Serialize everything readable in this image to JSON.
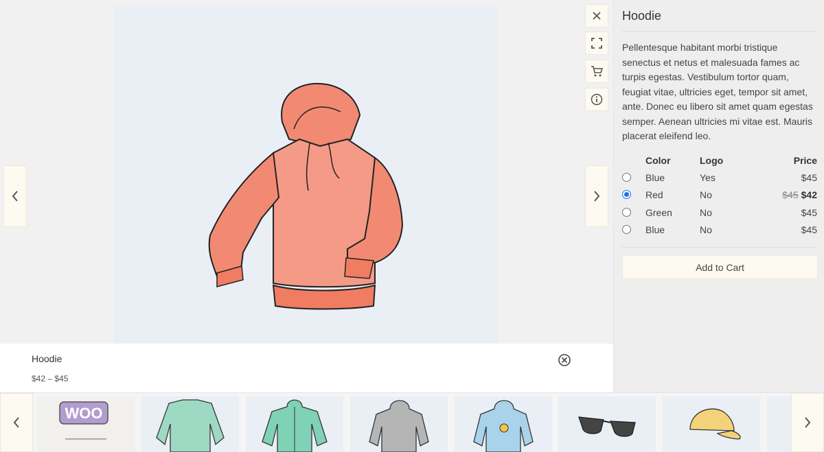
{
  "product": {
    "title": "Hoodie",
    "price_range": "$42 – $45",
    "description": "Pellentesque habitant morbi tristique senectus et netus et malesuada fames ac turpis egestas. Vestibulum tortor quam, feugiat vitae, ultricies eget, tempor sit amet, ante. Donec eu libero sit amet quam egestas semper. Aenean ultricies mi vitae est. Mauris placerat eleifend leo."
  },
  "toolbar": {
    "close_icon": "close-icon",
    "fullscreen_icon": "fullscreen-icon",
    "cart_icon": "cart-icon",
    "info_icon": "info-icon"
  },
  "variations": {
    "headers": {
      "color": "Color",
      "logo": "Logo",
      "price": "Price"
    },
    "rows": [
      {
        "color": "Blue",
        "logo": "Yes",
        "price": "$45",
        "old_price": "",
        "selected": false
      },
      {
        "color": "Red",
        "logo": "No",
        "price": "$42",
        "old_price": "$45",
        "selected": true
      },
      {
        "color": "Green",
        "logo": "No",
        "price": "$45",
        "old_price": "",
        "selected": false
      },
      {
        "color": "Blue",
        "logo": "No",
        "price": "$45",
        "old_price": "",
        "selected": false
      }
    ]
  },
  "add_to_cart_label": "Add to Cart",
  "thumbnails": [
    {
      "name": "woo-album",
      "label": "WOO"
    },
    {
      "name": "green-sweater",
      "label": ""
    },
    {
      "name": "green-zip-hoodie",
      "label": ""
    },
    {
      "name": "gray-hoodie",
      "label": ""
    },
    {
      "name": "blue-emoji-hoodie",
      "label": ""
    },
    {
      "name": "sunglasses",
      "label": ""
    },
    {
      "name": "yellow-cap",
      "label": ""
    },
    {
      "name": "partial-item",
      "label": ""
    }
  ],
  "colors": {
    "accent": "#1a73e8",
    "button_bg": "#fdfbf1",
    "hoodie": "#f28a73"
  }
}
